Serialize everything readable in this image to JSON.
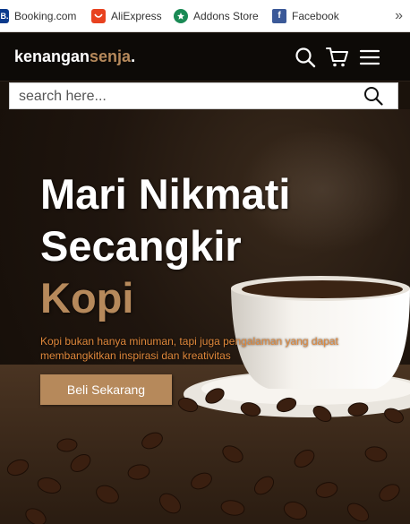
{
  "bookmarks": {
    "items": [
      {
        "label": "Booking.com",
        "icon": "booking-icon",
        "badge": "B."
      },
      {
        "label": "AliExpress",
        "icon": "aliexpress-icon"
      },
      {
        "label": "Addons Store",
        "icon": "addons-store-icon"
      },
      {
        "label": "Facebook",
        "icon": "facebook-icon",
        "badge": "f"
      }
    ],
    "more": "»"
  },
  "navbar": {
    "logo_main": "kenangan",
    "logo_accent": "senja",
    "logo_dot": ".",
    "icons": [
      "search-icon",
      "cart-icon",
      "hamburger-menu-icon"
    ]
  },
  "search": {
    "placeholder": "search here..."
  },
  "hero": {
    "title_line1": "Mari Nikmati",
    "title_line2": "Secangkir",
    "title_line3": "Kopi",
    "description": "Kopi bukan hanya minuman, tapi juga pengalaman yang dapat membangkitkan inspirasi dan kreativitas",
    "cta": "Beli Sekarang"
  },
  "colors": {
    "accent": "#b6895b",
    "description": "#e0883b",
    "navbar": "#0d0a07"
  }
}
